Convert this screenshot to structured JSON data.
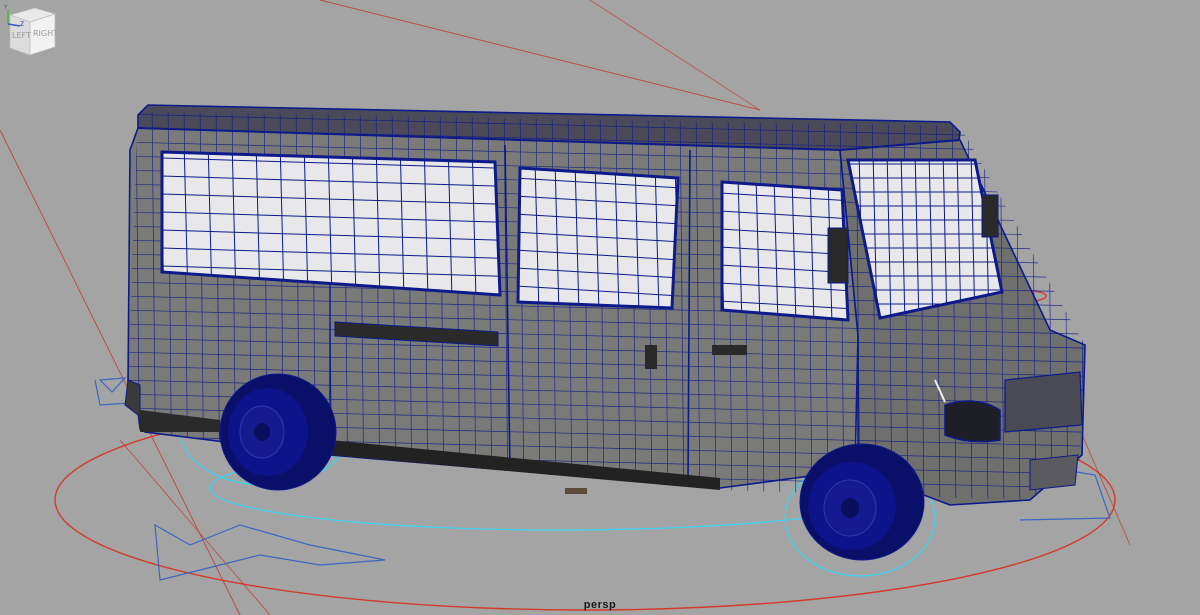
{
  "viewport": {
    "camera_name": "persp",
    "background_color": "#a4a4a4",
    "wireframe_color": "#0c1a8a",
    "selection_color": "#37d6f5",
    "grid_circle_color": "#d33a2a"
  },
  "viewcube": {
    "face_left": "LEFT",
    "face_right": "RIGHT"
  },
  "axis_indicator": {
    "y": "Y",
    "z": "Z"
  }
}
